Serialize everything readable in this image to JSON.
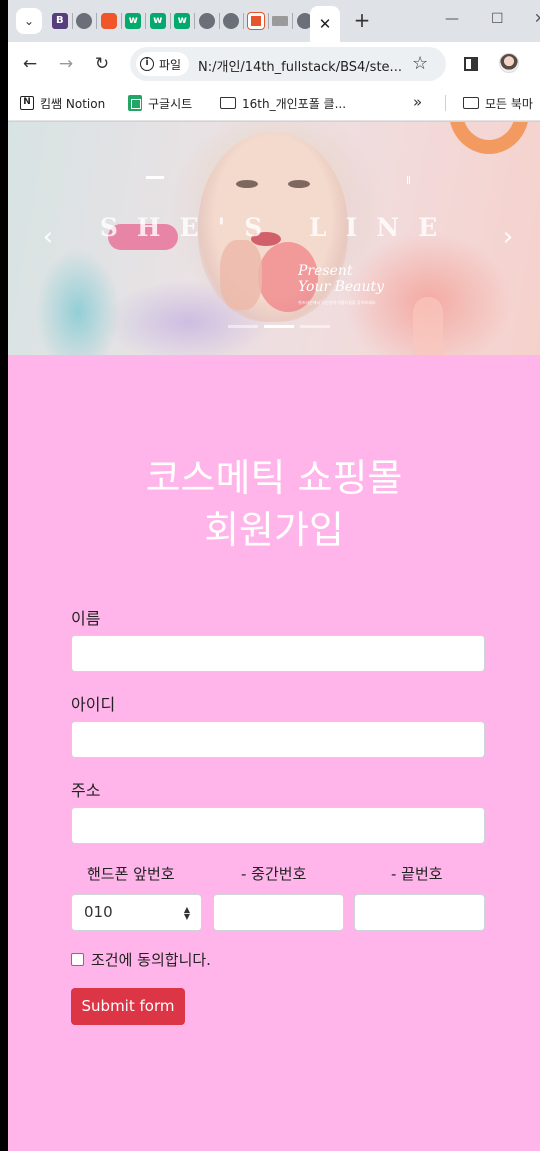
{
  "browser": {
    "tab_favicons": [
      "bootstrap-icon",
      "globe-icon",
      "brave-icon",
      "w3schools-icon",
      "w3schools-icon",
      "w3schools-icon",
      "globe-icon",
      "globe-icon",
      "red-square-icon",
      "thumbnail-icon",
      "globe-icon"
    ],
    "active_tab_close": "✕",
    "new_tab": "+",
    "site_chip_label": "파일",
    "url": "N:/개인/14th_fullstack/BS4/ste...",
    "bookmarks": [
      {
        "label": "킴쌤 Notion",
        "icon": "notion-icon"
      },
      {
        "label": "구글시트",
        "icon": "google-sheets-icon"
      },
      {
        "label": "16th_개인포폴 클...",
        "icon": "folder-icon"
      },
      {
        "label": "모든 북마",
        "icon": "folder-icon"
      }
    ],
    "bookmarks_more": "»"
  },
  "banner": {
    "brand": "SHE'S LINE",
    "tagline_line1": "Present",
    "tagline_line2": "Your Beauty",
    "tagline_small": "쉬즈라인에서 당신만의 아름다움을 찾아보세요",
    "slide_count": 3,
    "active_slide": 2
  },
  "form": {
    "title_line1": "코스메틱 쇼핑몰",
    "title_line2": "회원가입",
    "name_label": "이름",
    "id_label": "아이디",
    "address_label": "주소",
    "phone_first_label": "핸드폰 앞번호",
    "phone_middle_label": "- 중간번호",
    "phone_last_label": "- 끝번호",
    "phone_first_value": "010",
    "agree_label": "조건에 동의합니다.",
    "submit_label": "Submit form"
  },
  "colors": {
    "page_background": "#ffb4ea",
    "submit_button": "#dc3545"
  }
}
